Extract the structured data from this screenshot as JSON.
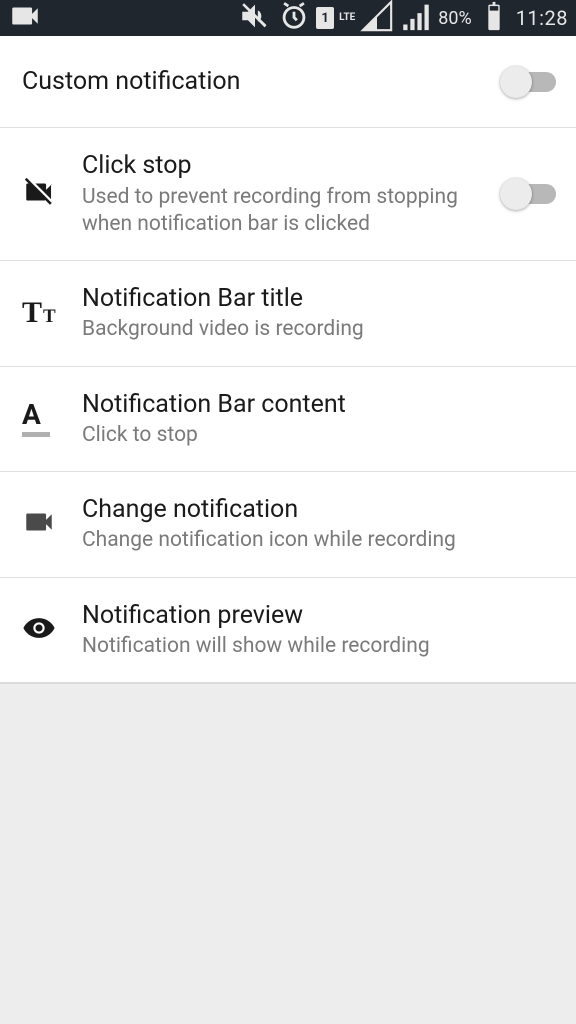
{
  "status": {
    "battery_pct": "80%",
    "time": "11:28",
    "net": "LTE",
    "sim": "1"
  },
  "rows": {
    "custom": {
      "title": "Custom notification"
    },
    "clickstop": {
      "title": "Click stop",
      "sub": "Used to prevent recording from stopping when notification bar is clicked"
    },
    "bartitle": {
      "title": "Notification Bar title",
      "sub": "Background video is recording"
    },
    "barcontent": {
      "title": "Notification Bar content",
      "sub": "Click to stop"
    },
    "changenotif": {
      "title": "Change notification",
      "sub": "Change notification icon while recording"
    },
    "preview": {
      "title": "Notification preview",
      "sub": "Notification will show while recording"
    }
  }
}
